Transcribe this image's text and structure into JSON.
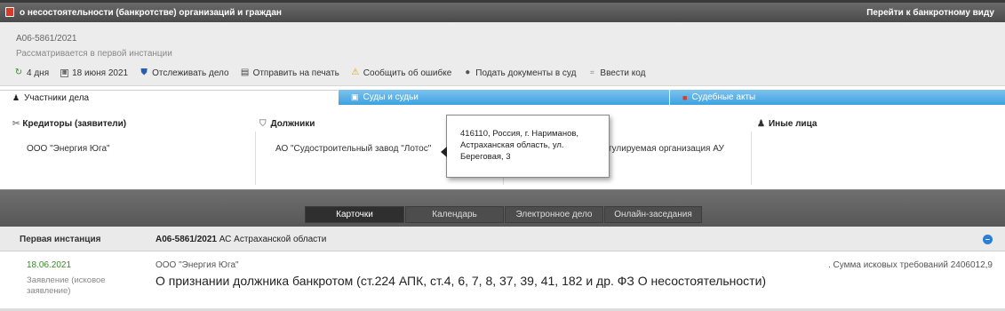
{
  "topbar": {
    "title": "о несостоятельности (банкротстве) организаций и граждан",
    "bankrupt_link": "Перейти к банкротному виду"
  },
  "case": {
    "number": "А06-5861/2021",
    "status": "Рассматривается в первой инстанции"
  },
  "toolbar": {
    "days": "4 дня",
    "date": "18 июня 2021",
    "track": "Отслеживать дело",
    "print": "Отправить на печать",
    "report_error": "Сообщить об ошибке",
    "submit_docs": "Подать документы в суд",
    "enter_code": "Ввести код"
  },
  "tabs": {
    "participants": "Участники дела",
    "courts": "Суды и судьи",
    "acts": "Судебные акты"
  },
  "participants": {
    "creditors_head": "Кредиторы (заявители)",
    "creditors_value": "ООО \"Энергия Юга\"",
    "debtors_head": "Должники",
    "debtors_value": "АО \"Судостроительный завод \"Лотос\"",
    "third_value": "гулируемая организация АУ",
    "others_head": "Иные лица"
  },
  "tooltip": {
    "line1": "416110, Россия, г. Нариманов,",
    "line2": "Астраханская область, ул.",
    "line3": "Береговая, 3"
  },
  "navtabs": [
    "Карточки",
    "Календарь",
    "Электронное дело",
    "Онлайн-заседания"
  ],
  "instance": {
    "label": "Первая инстанция",
    "case_number": "А06-5861/2021",
    "court": "АС Астраханской области"
  },
  "card": {
    "date": "18.06.2021",
    "type": "Заявление (исковое заявление)",
    "party": "ООО \"Энергия Юга\"",
    "description": "О признании должника банкротом (ст.224 АПК, ст.4, 6, 7, 8, 37, 39, 41, 182 и др. ФЗ О несостоятельности)",
    "claim": ". Сумма исковых требований 2406012,9"
  },
  "colors": {
    "accent_blue": "#3da2df",
    "date_green": "#3a8a2a",
    "dark_bar": "#575757"
  }
}
